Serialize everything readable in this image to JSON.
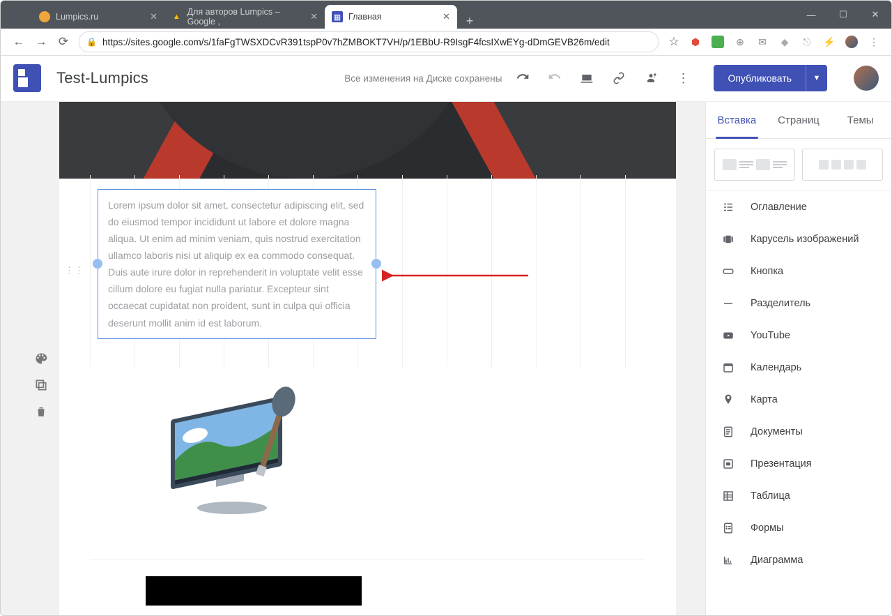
{
  "browser": {
    "tabs": [
      {
        "title": "Lumpics.ru",
        "active": false
      },
      {
        "title": "Для авторов Lumpics – Google ,",
        "active": false
      },
      {
        "title": "Главная",
        "active": true
      }
    ],
    "url": "https://sites.google.com/s/1faFgTWSXDCvR391tspP0v7hZMBOKT7VH/p/1EBbU-R9IsgF4fcsIXwEYg-dDmGEVB26m/edit"
  },
  "app": {
    "doc_title": "Test-Lumpics",
    "save_status": "Все изменения на Диске сохранены",
    "publish_label": "Опубликовать",
    "tabs": {
      "insert": "Вставка",
      "pages": "Страниц",
      "themes": "Темы"
    }
  },
  "text_block": "Lorem ipsum dolor sit amet, consectetur adipiscing elit, sed do eiusmod tempor incididunt ut labore et dolore magna aliqua. Ut enim ad minim veniam, quis nostrud exercitation ullamco laboris nisi ut aliquip ex ea commodo consequat. Duis aute irure dolor in reprehenderit in voluptate velit esse cillum dolore eu fugiat nulla pariatur. Excepteur sint occaecat cupidatat non proident, sunt in culpa qui officia deserunt mollit anim id est laborum.",
  "insert_items": [
    {
      "label": "Оглавление",
      "icon": "toc"
    },
    {
      "label": "Карусель изображений",
      "icon": "carousel"
    },
    {
      "label": "Кнопка",
      "icon": "button"
    },
    {
      "label": "Разделитель",
      "icon": "divider"
    },
    {
      "label": "YouTube",
      "icon": "youtube"
    },
    {
      "label": "Календарь",
      "icon": "calendar"
    },
    {
      "label": "Карта",
      "icon": "map"
    },
    {
      "label": "Документы",
      "icon": "docs"
    },
    {
      "label": "Презентация",
      "icon": "slides"
    },
    {
      "label": "Таблица",
      "icon": "sheets"
    },
    {
      "label": "Формы",
      "icon": "forms"
    },
    {
      "label": "Диаграмма",
      "icon": "chart"
    }
  ]
}
